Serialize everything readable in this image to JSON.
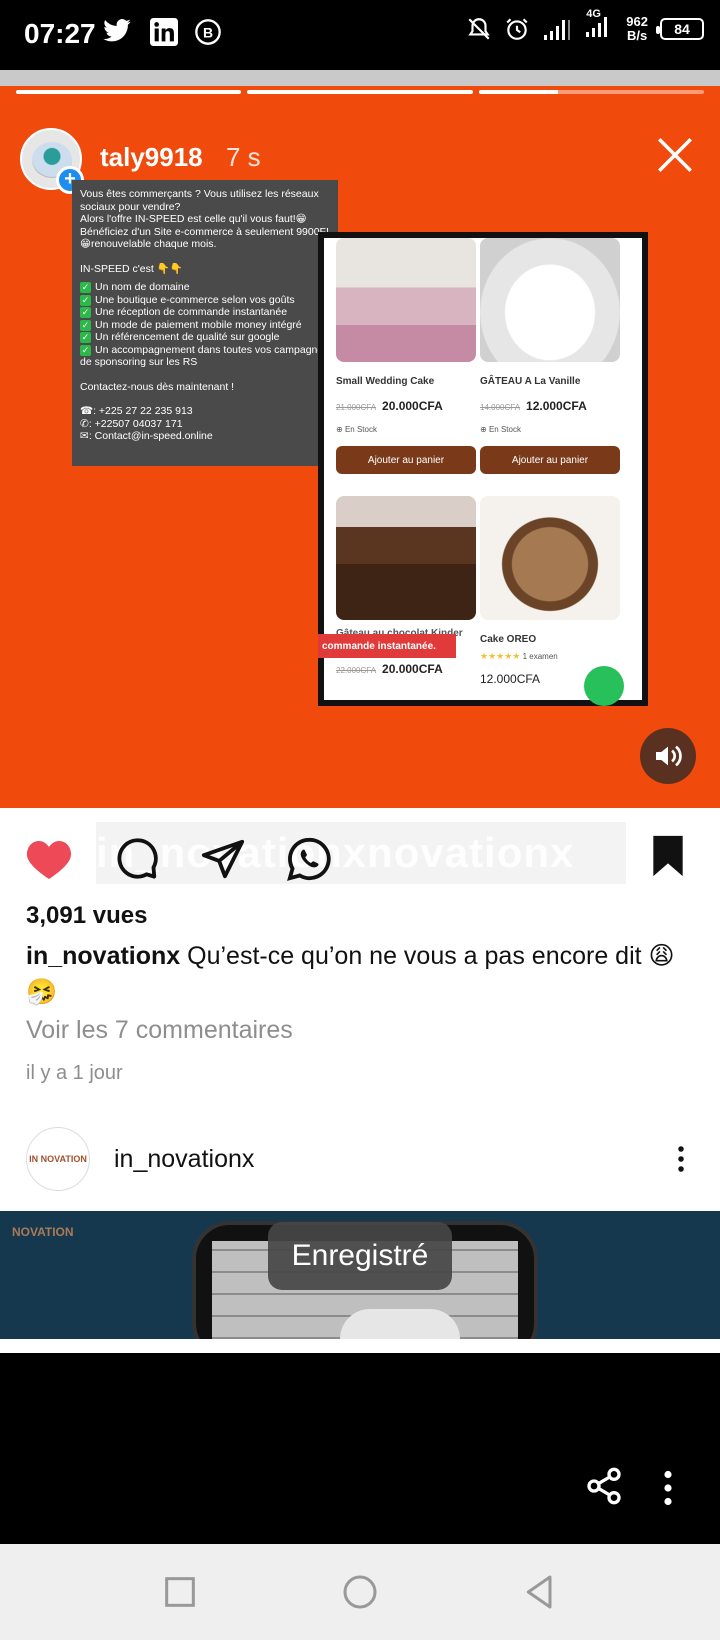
{
  "status_bar": {
    "time": "07:27",
    "network": "4G",
    "speed_value": "962",
    "speed_unit": "B/s",
    "battery": "84",
    "icons": [
      "twitter-icon",
      "linkedin-icon",
      "b-icon",
      "mute-icon",
      "alarm-icon",
      "signal-icon",
      "signal-4g-icon",
      "battery-icon"
    ]
  },
  "story": {
    "progress": [
      1.0,
      1.0,
      0.35
    ],
    "username": "taly9918",
    "time_ago": "7 s",
    "bg_color": "#f04a0c",
    "ad": {
      "intro": "Vous êtes commerçants ? Vous utilisez les réseaux sociaux pour vendre?",
      "intro2": "Alors l'offre IN-SPEED est celle qu'il vous faut!😁 Bénéficiez d'un Site e-commerce à seulement 9900F!😁renouvelable chaque mois.",
      "heading": "IN-SPEED c'est 👇👇",
      "features": [
        "Un nom de domaine",
        "Une boutique e-commerce selon vos goûts",
        "Une réception de commande instantanée",
        "Un mode de paiement mobile money intégré",
        "Un référencement de qualité sur google",
        "Un accompagnement dans toutes vos campagnes de sponsoring sur les RS"
      ],
      "contact_cta": "Contactez-nous dès maintenant !",
      "phone1": ": +225 27 22 235 913",
      "phone2": ": +22507 04037 171",
      "email": ": Contact@in-speed.online"
    },
    "shop": {
      "products": [
        {
          "name": "Small Wedding Cake",
          "old_price": "21.000CFA",
          "price": "20.000CFA",
          "stock": "En Stock",
          "button": "Ajouter au panier"
        },
        {
          "name": "GÂTEAU A La Vanille",
          "old_price": "14.000CFA",
          "price": "12.000CFA",
          "stock": "En Stock",
          "button": "Ajouter au panier"
        },
        {
          "name": "Gâteau au chocolat Kinder Bueno",
          "old_price": "22.000CFA",
          "price": "20.000CFA"
        },
        {
          "name": "Cake OREO",
          "rating": "★★★★★",
          "reviews": "1 examen",
          "price": "12.000CFA"
        }
      ],
      "banner": "commande instantanée."
    }
  },
  "post": {
    "watermark": "in_novationxnovationx",
    "views": "3,091 vues",
    "author": "in_novationx",
    "caption_text": " Qu’est-ce qu’on ne vous a pas encore dit 😩🤧",
    "comments_link": "Voir les 7 commentaires",
    "date": "il y a 1 jour",
    "liked": true,
    "like_color": "#ed4956"
  },
  "next_post": {
    "avatar_text": "IN NOVATION",
    "username": "in_novationx",
    "preview_logo": "NOVATION"
  },
  "toast": {
    "text": "Enregistré"
  },
  "navbar": {
    "items": [
      "recents-icon",
      "home-icon",
      "back-icon"
    ]
  }
}
